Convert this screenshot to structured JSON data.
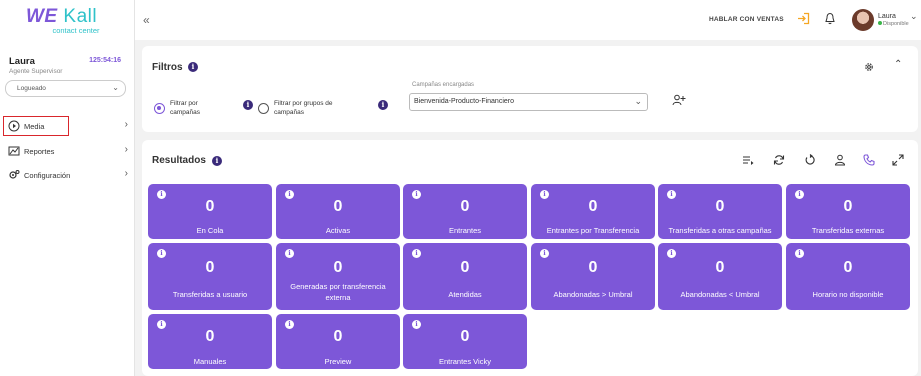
{
  "brand": {
    "name_we": "WE",
    "name_kall": "Kall",
    "tagline": "contact center"
  },
  "user": {
    "name": "Laura",
    "role": "Agente Supervisor",
    "timer": "125:54:16",
    "status": "Logueado"
  },
  "nav": [
    {
      "label": "Media",
      "icon": "play-circle-icon"
    },
    {
      "label": "Reportes",
      "icon": "chart-icon"
    },
    {
      "label": "Configuración",
      "icon": "settings-icon"
    }
  ],
  "topbar": {
    "collapse": "«",
    "talk_sales": "HABLAR CON VENTAS",
    "user_name": "Laura",
    "user_status": "Disponible"
  },
  "filters": {
    "title": "Filtros",
    "radio_campaigns": "Filtrar por campañas",
    "radio_groups": "Filtrar por grupos de campañas",
    "campaigns_label": "Campañas encargadas",
    "campaigns_value": "Bienvenida-Producto-Financiero"
  },
  "results": {
    "title": "Resultados",
    "tiles": [
      {
        "value": "0",
        "label": "En Cola"
      },
      {
        "value": "0",
        "label": "Activas"
      },
      {
        "value": "0",
        "label": "Entrantes"
      },
      {
        "value": "0",
        "label": "Entrantes por Transferencia"
      },
      {
        "value": "0",
        "label": "Transferidas a otras campañas"
      },
      {
        "value": "0",
        "label": "Transferidas externas"
      },
      {
        "value": "0",
        "label": "Transferidas a usuario"
      },
      {
        "value": "0",
        "label": "Generadas por transferencia externa"
      },
      {
        "value": "0",
        "label": "Atendidas"
      },
      {
        "value": "0",
        "label": "Abandonadas > Umbral"
      },
      {
        "value": "0",
        "label": "Abandonadas < Umbral"
      },
      {
        "value": "0",
        "label": "Horario no disponible"
      },
      {
        "value": "0",
        "label": "Manuales"
      },
      {
        "value": "0",
        "label": "Preview"
      },
      {
        "value": "0",
        "label": "Entrantes Vicky"
      }
    ]
  },
  "colors": {
    "accent": "#7d57d8",
    "brand_teal": "#2fc2c9",
    "highlight": "#d9262c",
    "sales_orange": "#f5a623"
  }
}
